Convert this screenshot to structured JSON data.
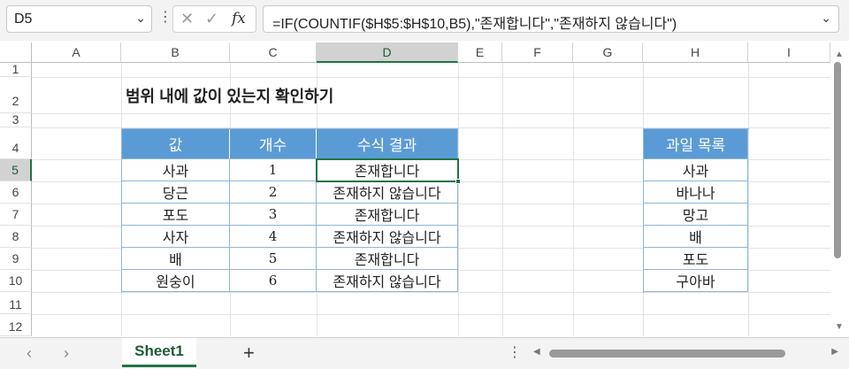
{
  "formula_bar": {
    "name_box": "D5",
    "formula": "=IF(COUNTIF($H$5:$H$10,B5),\"존재합니다\",\"존재하지 않습니다\")",
    "fx_label": "fx"
  },
  "columns": [
    "A",
    "B",
    "C",
    "D",
    "E",
    "F",
    "G",
    "H",
    "I"
  ],
  "rows": [
    "1",
    "2",
    "3",
    "4",
    "5",
    "6",
    "7",
    "8",
    "9",
    "10",
    "11",
    "12"
  ],
  "title": "범위 내에 값이 있는지 확인하기",
  "main_table": {
    "headers": [
      "값",
      "개수",
      "수식 결과"
    ],
    "rows": [
      [
        "사과",
        "1",
        "존재합니다"
      ],
      [
        "당근",
        "2",
        "존재하지 않습니다"
      ],
      [
        "포도",
        "3",
        "존재합니다"
      ],
      [
        "사자",
        "4",
        "존재하지 않습니다"
      ],
      [
        "배",
        "5",
        "존재합니다"
      ],
      [
        "원숭이",
        "6",
        "존재하지 않습니다"
      ]
    ]
  },
  "fruit_list": {
    "header": "과일 목록",
    "items": [
      "사과",
      "바나나",
      "망고",
      "배",
      "포도",
      "구아바"
    ]
  },
  "sheet_tabs": {
    "active": "Sheet1"
  },
  "colors": {
    "header_fill": "#5b9bd5",
    "selection": "#217346"
  }
}
